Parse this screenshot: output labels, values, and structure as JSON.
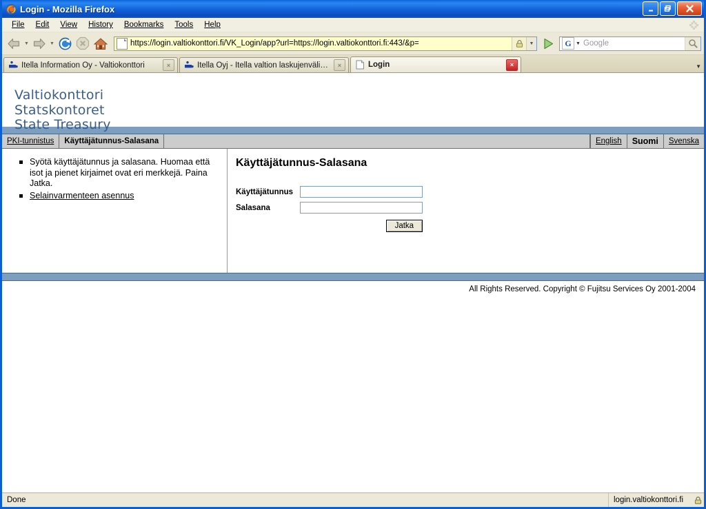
{
  "window": {
    "title": "Login - Mozilla Firefox",
    "minimize_label": "_",
    "maximize_label": "❐",
    "close_label": "✕"
  },
  "menu": {
    "items": [
      {
        "label": "File",
        "accel": "F"
      },
      {
        "label": "Edit",
        "accel": "E"
      },
      {
        "label": "View",
        "accel": "V"
      },
      {
        "label": "History",
        "accel": "s"
      },
      {
        "label": "Bookmarks",
        "accel": "B"
      },
      {
        "label": "Tools",
        "accel": "T"
      },
      {
        "label": "Help",
        "accel": "H"
      }
    ]
  },
  "toolbar": {
    "back_icon": "back-arrow-icon",
    "forward_icon": "forward-arrow-icon",
    "reload_icon": "reload-icon",
    "stop_icon": "stop-icon",
    "home_icon": "home-icon",
    "url": "https://login.valtiokonttori.fi/VK_Login/app?url=https://login.valtiokonttori.fi:443/&p=",
    "go_icon": "go-arrow-icon",
    "search_engine": "G",
    "search_placeholder": "Google",
    "search_value": "",
    "search_icon": "magnifier-icon",
    "lock_icon": "padlock-icon"
  },
  "tabs": [
    {
      "label": "Itella Information Oy - Valtiokonttori",
      "active": false,
      "close_label": "×"
    },
    {
      "label": "Itella Oyj - Itella valtion laskujenvälity…",
      "active": false,
      "close_label": "×"
    },
    {
      "label": "Login",
      "active": true,
      "close_label": "×"
    }
  ],
  "tab_list_caret": "▼",
  "page": {
    "logo": {
      "line1": "Valtiokonttori",
      "line2": "Statskontoret",
      "line3": "State Treasury"
    },
    "nav": {
      "tabs": [
        {
          "label": "PKI-tunnistus",
          "active": false
        },
        {
          "label": "Käyttäjätunnus-Salasana",
          "active": true
        }
      ],
      "languages": [
        {
          "label": "English",
          "active": false
        },
        {
          "label": "Suomi",
          "active": true
        },
        {
          "label": "Svenska",
          "active": false
        }
      ]
    },
    "instructions": [
      {
        "text": "Syötä käyttäjätunnus ja salasana. Huomaa että isot ja pienet kirjaimet ovat eri merkkejä. Paina Jatka.",
        "link": false
      },
      {
        "text": "Selainvarmenteen asennus",
        "link": true
      }
    ],
    "form": {
      "heading": "Käyttäjätunnus-Salasana",
      "username_label": "Käyttäjätunnus",
      "username_value": "",
      "password_label": "Salasana",
      "password_value": "",
      "submit_label": "Jatka"
    },
    "copyright": "All Rights Reserved. Copyright © Fujitsu Services Oy 2001-2004"
  },
  "statusbar": {
    "status": "Done",
    "host": "login.valtiokonttori.fi",
    "lock_icon": "padlock-icon"
  },
  "colors": {
    "titlebar_blue": "#0b64d8",
    "brand_blue": "#3c5d8a",
    "page_bluebar": "#7e9ec0",
    "navrow_gray": "#cccccc",
    "url_yellow": "#ffffcc",
    "chrome_tan": "#ece9d8"
  }
}
